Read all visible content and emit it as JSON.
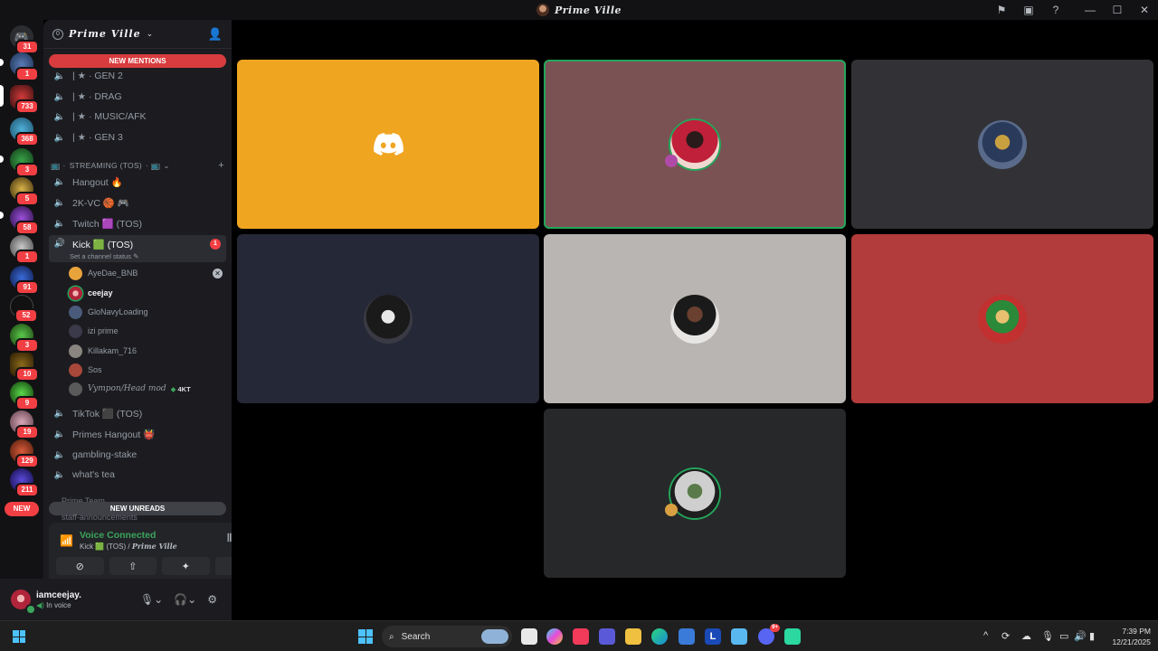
{
  "titlebar": {
    "title": "Prime Ville"
  },
  "rail": {
    "servers": [
      {
        "badge": "31"
      },
      {
        "badge": "1"
      },
      {
        "badge": "733"
      },
      {
        "badge": "368"
      },
      {
        "badge": "3"
      },
      {
        "badge": "5"
      },
      {
        "badge": "58"
      },
      {
        "badge": "1"
      },
      {
        "badge": "91"
      },
      {
        "badge": "52"
      },
      {
        "badge": "3"
      },
      {
        "badge": "10"
      },
      {
        "badge": "9"
      },
      {
        "badge": "19"
      },
      {
        "badge": "129"
      },
      {
        "badge": "211"
      }
    ],
    "new_label": "NEW"
  },
  "server": {
    "name": "Prime Ville",
    "boost_count": "0",
    "new_mentions_label": "NEW MENTIONS",
    "new_unreads_label": "NEW UNREADS"
  },
  "channels": {
    "top": [
      {
        "label": "| ★ · GEN 2"
      },
      {
        "label": "| ★ · DRAG"
      },
      {
        "label": "| ★ · MUSIC/AFK"
      },
      {
        "label": "| ★ · GEN 3"
      }
    ],
    "category": "STREAMING (TOS)",
    "streaming": [
      {
        "label": "Hangout 🔥"
      },
      {
        "label": "2K-VC 🏀 🎮"
      },
      {
        "label": "Twitch 🟪 (TOS)"
      }
    ],
    "active": {
      "label": "Kick 🟩 (TOS)",
      "unread": "1",
      "status": "Set a channel status"
    },
    "users": [
      {
        "name": "AyeDae_BNB",
        "tag": ""
      },
      {
        "name": "ceejay",
        "tag": ""
      },
      {
        "name": "GloNavyLoading",
        "tag": ""
      },
      {
        "name": "izi prime",
        "tag": ""
      },
      {
        "name": "Killakam_716",
        "tag": ""
      },
      {
        "name": "Sos",
        "tag": ""
      },
      {
        "name": "Vympon/Head mod",
        "tag": "4KT"
      }
    ],
    "after": [
      {
        "label": "TikTok ⬛ (TOS)"
      },
      {
        "label": "Primes Hangout 👹"
      },
      {
        "label": "gambling-stake"
      },
      {
        "label": "what's tea"
      }
    ],
    "cut_category": "Prime Team",
    "cut_channel": "staff-announcements"
  },
  "voice": {
    "title": "Voice Connected",
    "channel": "Kick 🟩 (TOS) /",
    "server": "Prime Ville"
  },
  "user": {
    "name": "iamceejay.",
    "status": "In voice"
  },
  "taskbar": {
    "search_label": "Search",
    "discord_badge": "9+",
    "time": "7:39 PM",
    "date": "12/21/2025"
  },
  "colors": {
    "tile_discord": "#f0a521",
    "tile_ceejay": "#7a5253",
    "tile_3": "#323236",
    "tile_4": "#252836",
    "tile_5": "#b9b5b2",
    "tile_6": "#b23b3b",
    "tile_7": "#26282a",
    "speaking": "#23a55a",
    "voice_green": "#3ba55c"
  }
}
